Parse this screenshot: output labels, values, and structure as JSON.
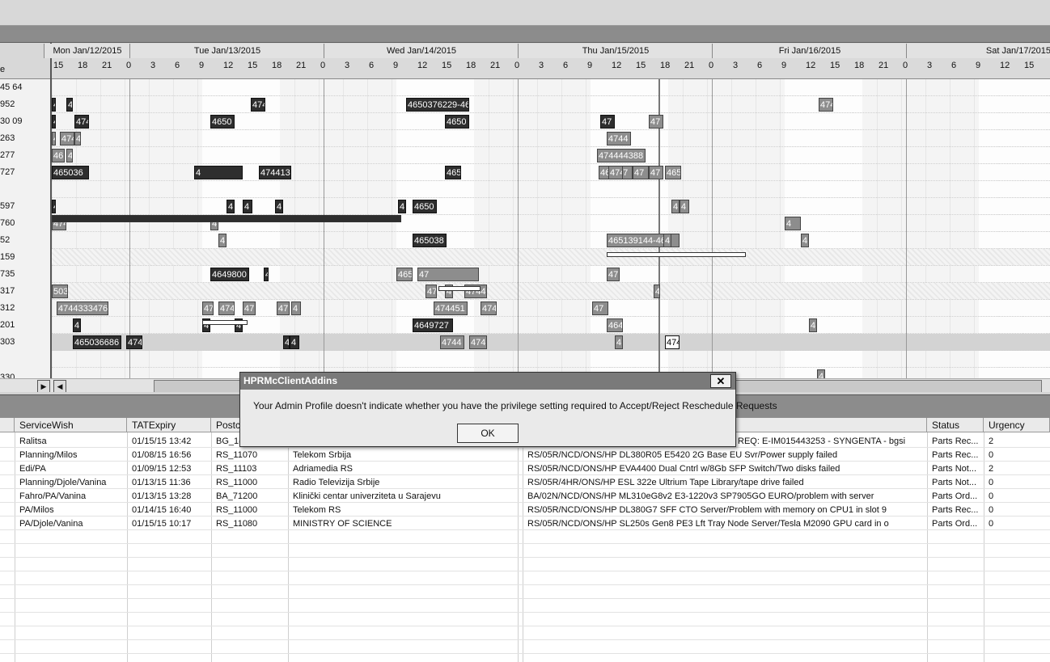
{
  "gantt": {
    "row_header_caption": "e",
    "row_labels": [
      "45 64",
      "952",
      "30 09",
      "263",
      "277",
      "727",
      "",
      "597",
      "760",
      "52",
      "159",
      "735",
      "317",
      "312",
      "201",
      "303",
      "",
      "330"
    ],
    "days": [
      "Mon Jan/12/2015",
      "Tue Jan/13/2015",
      "Wed Jan/14/2015",
      "Thu Jan/15/2015",
      "Fri Jan/16/2015",
      "Sat Jan/17/2015"
    ],
    "hours": [
      "15",
      "18",
      "21",
      "0",
      "3",
      "6",
      "9",
      "12",
      "15",
      "18",
      "21",
      "0",
      "3",
      "6",
      "9",
      "12",
      "15",
      "18",
      "21",
      "0",
      "3",
      "6",
      "9",
      "12",
      "15",
      "18",
      "21",
      "0",
      "3",
      "6",
      "9",
      "12",
      "15",
      "18",
      "21",
      "0",
      "3",
      "6",
      "9",
      "12",
      "15"
    ],
    "bar_labels": {
      "r1": [
        "4",
        "4",
        "474",
        "4650376229-46",
        "474"
      ],
      "r2": [
        "4",
        "474",
        "4650",
        "4650",
        "47",
        "47"
      ],
      "r3": [
        "4",
        "474",
        "4",
        "4744"
      ],
      "r4": [
        "46",
        "4",
        "474444388"
      ],
      "r5": [
        "465036",
        "4",
        "474413721",
        "465036",
        "465",
        "47",
        "47",
        "47",
        "465",
        "474"
      ],
      "r7": [
        "4",
        "4",
        "4",
        "4",
        "4",
        "4650",
        "4",
        "4"
      ],
      "r8": [
        "474",
        "474",
        "4"
      ],
      "r9": [
        "474",
        "4",
        "465038",
        "465139144-461",
        "4",
        "4"
      ],
      "r11": [
        "4649800",
        "47",
        "4650366869-4",
        "47",
        "47"
      ],
      "r12": [
        "503",
        "47",
        "4",
        "4744",
        "4"
      ],
      "r13": [
        "4744333476",
        "47",
        "474",
        "47",
        "47",
        "4",
        "474451",
        "474",
        "47"
      ],
      "r14": [
        "4",
        "4",
        "4",
        "4649727",
        "464",
        "4"
      ],
      "r15": [
        "465036686",
        "474",
        "4",
        "4",
        "4744",
        "474",
        "4",
        "474"
      ],
      "r17": [
        "4"
      ]
    }
  },
  "dialog": {
    "title": "HPRMcClientAddins",
    "close": "✕",
    "message": "Your Admin Profile doesn't indicate whether you have the privilege setting required to Accept/Reject Reschedule Requests",
    "ok": "OK"
  },
  "table": {
    "headers": [
      "ServiceWish",
      "TATExpiry",
      "Postc",
      "",
      "",
      "Status",
      "Urgency"
    ],
    "rows": [
      {
        "wish": "Ralitsa",
        "tat": "01/15/15 13:42",
        "post": "BG_1(",
        "cust": "",
        "desc": "REQ: E-IM015443253 - SYNGENTA - bgsi",
        "status": "Parts Rec...",
        "urg": "2"
      },
      {
        "wish": "Planning/Milos",
        "tat": "01/08/15 16:56",
        "post": "RS_11070",
        "cust": "Telekom Srbija",
        "desc": "RS/05R/NCD/ONS/HP DL380R05 E5420 2G Base EU Svr/Power supply failed",
        "status": "Parts Rec...",
        "urg": "0"
      },
      {
        "wish": "Edi/PA",
        "tat": "01/09/15 12:53",
        "post": "RS_11103",
        "cust": "Adriamedia RS",
        "desc": "RS/05R/NCD/ONS/HP EVA4400 Dual Cntrl w/8Gb SFP Switch/Two disks failed",
        "status": "Parts Not...",
        "urg": "2"
      },
      {
        "wish": "Planning/Djole/Vanina",
        "tat": "01/13/15 11:36",
        "post": "RS_11000",
        "cust": "Radio Televizija Srbije",
        "desc": "RS/05R/4HR/ONS/HP ESL 322e Ultrium Tape Library/tape drive failed",
        "status": "Parts Not...",
        "urg": "0"
      },
      {
        "wish": "Fahro/PA/Vanina",
        "tat": "01/13/15 13:28",
        "post": "BA_71200",
        "cust": "Klinički centar univerziteta u Sarajevu",
        "desc": "BA/02N/NCD/ONS/HP ML310eG8v2 E3-1220v3 SP7905GO EURO/problem with server",
        "status": "Parts Ord...",
        "urg": "0"
      },
      {
        "wish": "PA/Milos",
        "tat": "01/14/15 16:40",
        "post": "RS_11000",
        "cust": "Telekom RS",
        "desc": "RS/05R/NCD/ONS/HP DL380G7 SFF CTO Server/Problem with memory on CPU1 in slot 9",
        "status": "Parts Rec...",
        "urg": "0"
      },
      {
        "wish": "PA/Djole/Vanina",
        "tat": "01/15/15 10:17",
        "post": "RS_11080",
        "cust": "MINISTRY OF SCIENCE",
        "desc": "RS/05R/NCD/ONS/HP SL250s Gen8 PE3 Lft Tray Node Server/Tesla M2090 GPU card in o",
        "status": "Parts Ord...",
        "urg": "0"
      }
    ]
  }
}
